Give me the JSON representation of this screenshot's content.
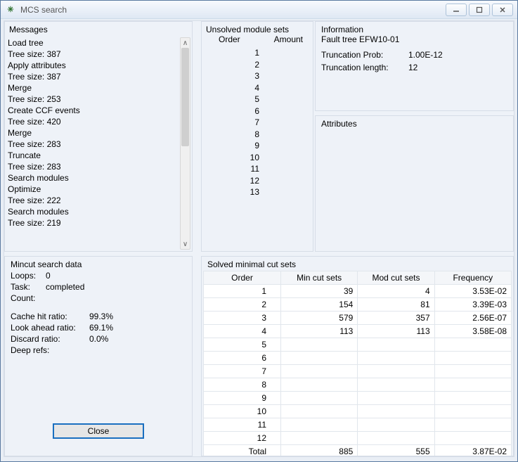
{
  "window": {
    "title": "MCS search"
  },
  "messages": {
    "label": "Messages",
    "lines": [
      "Load tree",
      "Tree size: 387",
      "Apply attributes",
      "Tree size: 387",
      "Merge",
      "Tree size: 253",
      "Create CCF events",
      "Tree size: 420",
      "Merge",
      "Tree size: 283",
      "Truncate",
      "Tree size: 283",
      "Search modules",
      "Optimize",
      "Tree size: 222",
      "Search modules",
      "Tree size: 219"
    ]
  },
  "unsolved": {
    "label": "Unsolved module sets",
    "col_order": "Order",
    "col_amount": "Amount",
    "orders": [
      "1",
      "2",
      "3",
      "4",
      "5",
      "6",
      "7",
      "8",
      "9",
      "10",
      "11",
      "12",
      "13"
    ]
  },
  "info": {
    "label": "Information",
    "fault_tree_label": "Fault tree",
    "fault_tree_value": "EFW10-01",
    "trunc_prob_label": "Truncation Prob:",
    "trunc_prob_value": "1.00E-12",
    "trunc_len_label": "Truncation length:",
    "trunc_len_value": "12"
  },
  "attributes": {
    "label": "Attributes"
  },
  "mincut": {
    "label": "Mincut search data",
    "loops_k": "Loops:",
    "loops_v": "0",
    "task_k": "Task:",
    "task_v": "completed",
    "count_k": "Count:",
    "count_v": "",
    "cache_k": "Cache hit ratio:",
    "cache_v": "99.3%",
    "look_k": "Look ahead ratio:",
    "look_v": "69.1%",
    "discard_k": "Discard ratio:",
    "discard_v": "0.0%",
    "deep_k": "Deep refs:",
    "deep_v": "",
    "close": "Close"
  },
  "solved": {
    "label": "Solved minimal cut sets",
    "headers": {
      "order": "Order",
      "min": "Min cut sets",
      "mod": "Mod cut sets",
      "freq": "Frequency"
    },
    "rows": [
      {
        "order": "1",
        "min": "39",
        "mod": "4",
        "freq": "3.53E-02"
      },
      {
        "order": "2",
        "min": "154",
        "mod": "81",
        "freq": "3.39E-03"
      },
      {
        "order": "3",
        "min": "579",
        "mod": "357",
        "freq": "2.56E-07"
      },
      {
        "order": "4",
        "min": "113",
        "mod": "113",
        "freq": "3.58E-08"
      },
      {
        "order": "5",
        "min": "",
        "mod": "",
        "freq": ""
      },
      {
        "order": "6",
        "min": "",
        "mod": "",
        "freq": ""
      },
      {
        "order": "7",
        "min": "",
        "mod": "",
        "freq": ""
      },
      {
        "order": "8",
        "min": "",
        "mod": "",
        "freq": ""
      },
      {
        "order": "9",
        "min": "",
        "mod": "",
        "freq": ""
      },
      {
        "order": "10",
        "min": "",
        "mod": "",
        "freq": ""
      },
      {
        "order": "11",
        "min": "",
        "mod": "",
        "freq": ""
      },
      {
        "order": "12",
        "min": "",
        "mod": "",
        "freq": ""
      }
    ],
    "total_label": "Total",
    "total_min": "885",
    "total_mod": "555",
    "total_freq": "3.87E-02"
  }
}
